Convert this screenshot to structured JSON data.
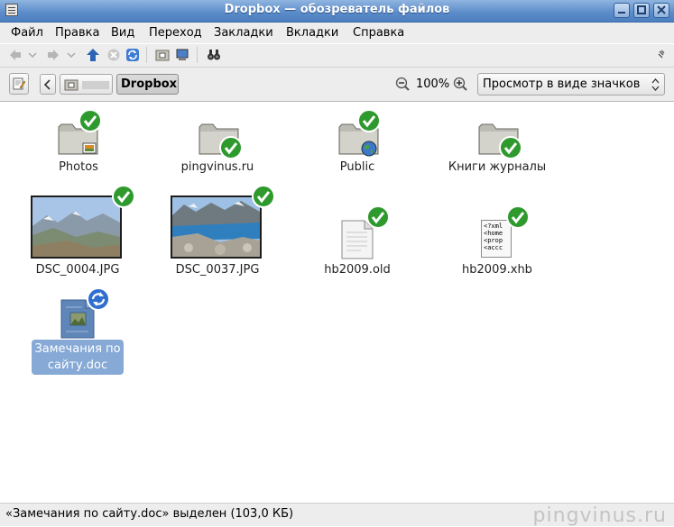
{
  "window": {
    "title": "Dropbox — обозреватель файлов"
  },
  "menu": [
    "Файл",
    "Правка",
    "Вид",
    "Переход",
    "Закладки",
    "Вкладки",
    "Справка"
  ],
  "location": {
    "crumb_hidden": "",
    "crumb_current": "Dropbox",
    "zoom": "100%",
    "view_mode": "Просмотр в виде значков"
  },
  "files": [
    {
      "name": "Photos",
      "kind": "folder",
      "emblem": "photos-icon",
      "status": "synced"
    },
    {
      "name": "pingvinus.ru",
      "kind": "folder",
      "emblem": "",
      "status": "synced"
    },
    {
      "name": "Public",
      "kind": "folder",
      "emblem": "globe-icon",
      "status": "synced"
    },
    {
      "name": "Книги журналы",
      "kind": "folder",
      "emblem": "",
      "status": "synced"
    },
    {
      "name": "DSC_0004.JPG",
      "kind": "image",
      "status": "synced"
    },
    {
      "name": "DSC_0037.JPG",
      "kind": "image",
      "status": "synced"
    },
    {
      "name": "hb2009.old",
      "kind": "text",
      "status": "synced"
    },
    {
      "name": "hb2009.xhb",
      "kind": "xml",
      "status": "synced"
    },
    {
      "name_line1": "Замечания по",
      "name_line2": "сайту.doc",
      "kind": "document",
      "status": "syncing",
      "selected": true
    }
  ],
  "xml_preview": [
    "<?xml",
    "<home",
    "<prop",
    "<accc"
  ],
  "status": {
    "text": "«Замечания по сайту.doc» выделен (103,0 КБ)",
    "watermark": "pingvinus.ru"
  },
  "colors": {
    "titlebar": "#5a8bc9",
    "selection": "#86a9d6",
    "synced": "#2e9a2e",
    "syncing": "#2f6fd0"
  }
}
